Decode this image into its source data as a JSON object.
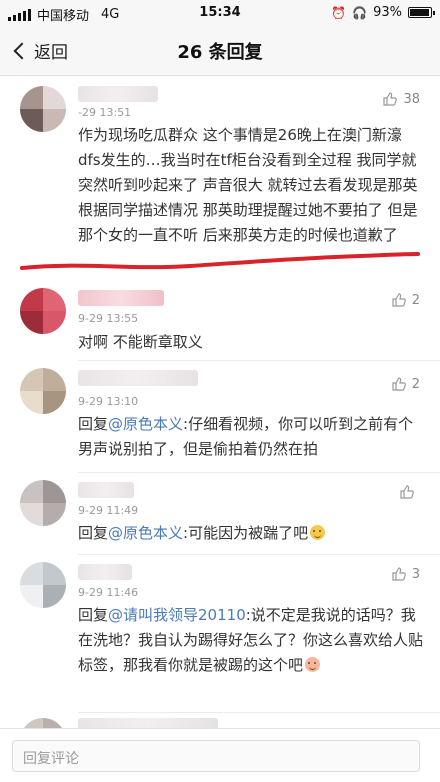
{
  "status_bar": {
    "carrier": "中国移动",
    "network": "4G",
    "time": "15:34",
    "battery_percent": "93%",
    "battery_level": 0.93
  },
  "nav": {
    "back_label": "返回",
    "title": "26 条回复"
  },
  "comments": [
    {
      "time": "-29 13:51",
      "likes": "38",
      "text": "作为现场吃瓜群众 这个事情是26晚上在澳门新濠dfs发生的…我当时在tf柜台没看到全过程 我同学就突然听到吵起来了 声音很大 就转过去看发现是那英 根据同学描述情况 那英助理提醒过她不要拍了 但是那个女的一直不听 后来那英方走的时候也道歉了"
    },
    {
      "time": "9-29 13:55",
      "likes": "2",
      "text": "对啊 不能断章取义"
    },
    {
      "time": "9-29 13:10",
      "likes": "2",
      "reply_prefix": "回复",
      "mention": "@原色本义",
      "text": ":仔细看视频，你可以听到之前有个男声说别拍了，但是偷拍着仍然在拍"
    },
    {
      "time": "9-29 11:49",
      "likes": "",
      "reply_prefix": "回复",
      "mention": "@原色本义",
      "text": ":可能因为被踹了吧"
    },
    {
      "time": "9-29 11:46",
      "likes": "3",
      "reply_prefix": "回复",
      "mention": "@请叫我领导20110",
      "text": ":说不定是我说的话吗？我在洗地？我自认为踢得好怎么了？你这么喜欢给人贴标签，那我看你就是被踢的这个吧"
    }
  ],
  "bottom": {
    "placeholder": "回复评论"
  },
  "colors": {
    "mention": "#4a7ab8",
    "annotation_red": "#d8232a"
  }
}
